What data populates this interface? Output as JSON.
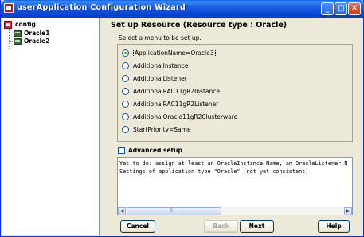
{
  "window": {
    "title": "userApplication Configuration Wizard",
    "controls": {
      "minimize": "_",
      "maximize": "□",
      "close": "✕"
    }
  },
  "tree": {
    "root": {
      "label": "config",
      "icon": "config-icon"
    },
    "children": [
      {
        "label": "Oracle1",
        "icon": "node-icon"
      },
      {
        "label": "Oracle2",
        "icon": "node-icon"
      }
    ]
  },
  "main": {
    "heading": "Set up Resource (Resource type : Oracle)",
    "subheading": "Select a menu to be set up.",
    "options": [
      {
        "label": "ApplicationName=Oracle3",
        "selected": true
      },
      {
        "label": "AdditionalInstance",
        "selected": false
      },
      {
        "label": "AdditionalListener",
        "selected": false
      },
      {
        "label": "AdditionalRAC11gR2Instance",
        "selected": false
      },
      {
        "label": "AdditionalRAC11gR2Listener",
        "selected": false
      },
      {
        "label": "AdditionalOracle11gR2Clusterware",
        "selected": false
      },
      {
        "label": "StartPriority=Same",
        "selected": false
      }
    ],
    "advanced_setup": {
      "label": "Advanced setup",
      "checked": false
    },
    "messages": [
      "Yet to do: assign at least an OracleInstance Name, an OracleListener N",
      "Settings of application type \"Oracle\" (not yet consistent)"
    ]
  },
  "buttons": {
    "cancel": "Cancel",
    "back": "Back",
    "next": "Next",
    "help": "Help"
  },
  "colors": {
    "titlebar": "#0846d4",
    "panel": "#ece9d8",
    "selected_radio": "#21a121"
  }
}
